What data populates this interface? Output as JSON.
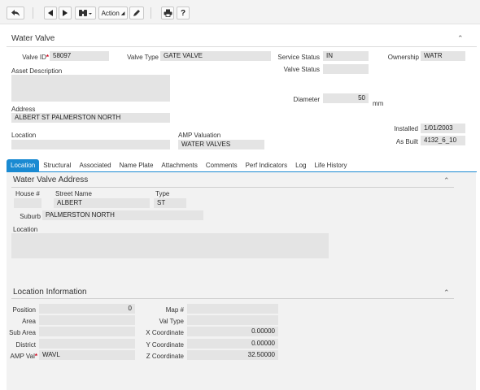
{
  "toolbar": {
    "back_icon": "back-arrow-icon",
    "prev_icon": "triangle-left-icon",
    "next_icon": "triangle-right-icon",
    "binoculars_icon": "binoculars-icon",
    "action_label": "Action",
    "edit_icon": "pencil-icon",
    "print_icon": "printer-icon",
    "help_label": "?"
  },
  "header": {
    "title": "Water Valve",
    "valve_id_label": "Valve ID",
    "valve_id_value": "58097",
    "valve_type_label": "Valve Type",
    "valve_type_value": "GATE VALVE",
    "service_status_label": "Service Status",
    "service_status_value": "IN",
    "ownership_label": "Ownership",
    "ownership_value": "WATR",
    "valve_status_label": "Valve Status",
    "valve_status_value": "",
    "asset_description_label": "Asset Description",
    "asset_description_value": "",
    "diameter_label": "Diameter",
    "diameter_value": "50",
    "diameter_unit": "mm",
    "address_label": "Address",
    "address_value": "ALBERT ST PALMERSTON NORTH",
    "installed_label": "Installed",
    "installed_value": "1/01/2003",
    "location_label": "Location",
    "location_value": "",
    "amp_valuation_label": "AMP Valuation",
    "amp_valuation_value": "WATER VALVES",
    "as_built_label": "As Built",
    "as_built_value": "4132_6_10"
  },
  "tabs": [
    {
      "label": "Location"
    },
    {
      "label": "Structural"
    },
    {
      "label": "Associated"
    },
    {
      "label": "Name Plate"
    },
    {
      "label": "Attachments"
    },
    {
      "label": "Comments"
    },
    {
      "label": "Perf Indicators"
    },
    {
      "label": "Log"
    },
    {
      "label": "Life History"
    }
  ],
  "address_section": {
    "title": "Water Valve Address",
    "house_label": "House #",
    "house_value": "",
    "street_name_label": "Street Name",
    "street_name_value": "ALBERT",
    "type_label": "Type",
    "type_value": "ST",
    "suburb_label": "Suburb",
    "suburb_value": "PALMERSTON NORTH",
    "location_label": "Location",
    "location_value": ""
  },
  "location_info": {
    "title": "Location Information",
    "position_label": "Position",
    "position_value": "0",
    "area_label": "Area",
    "area_value": "",
    "sub_area_label": "Sub Area",
    "sub_area_value": "",
    "district_label": "District",
    "district_value": "",
    "amp_val_label": "AMP Val",
    "amp_val_value": "WAVL",
    "map_label": "Map #",
    "map_value": "",
    "val_type_label": "Val Type",
    "val_type_value": "",
    "x_coord_label": "X Coordinate",
    "x_coord_value": "0.00000",
    "y_coord_label": "Y Coordinate",
    "y_coord_value": "0.00000",
    "z_coord_label": "Z Coordinate",
    "z_coord_value": "32.50000"
  },
  "colors": {
    "accent": "#1a8ad2",
    "field_bg": "#e4e4e4",
    "required": "#d0021b"
  }
}
